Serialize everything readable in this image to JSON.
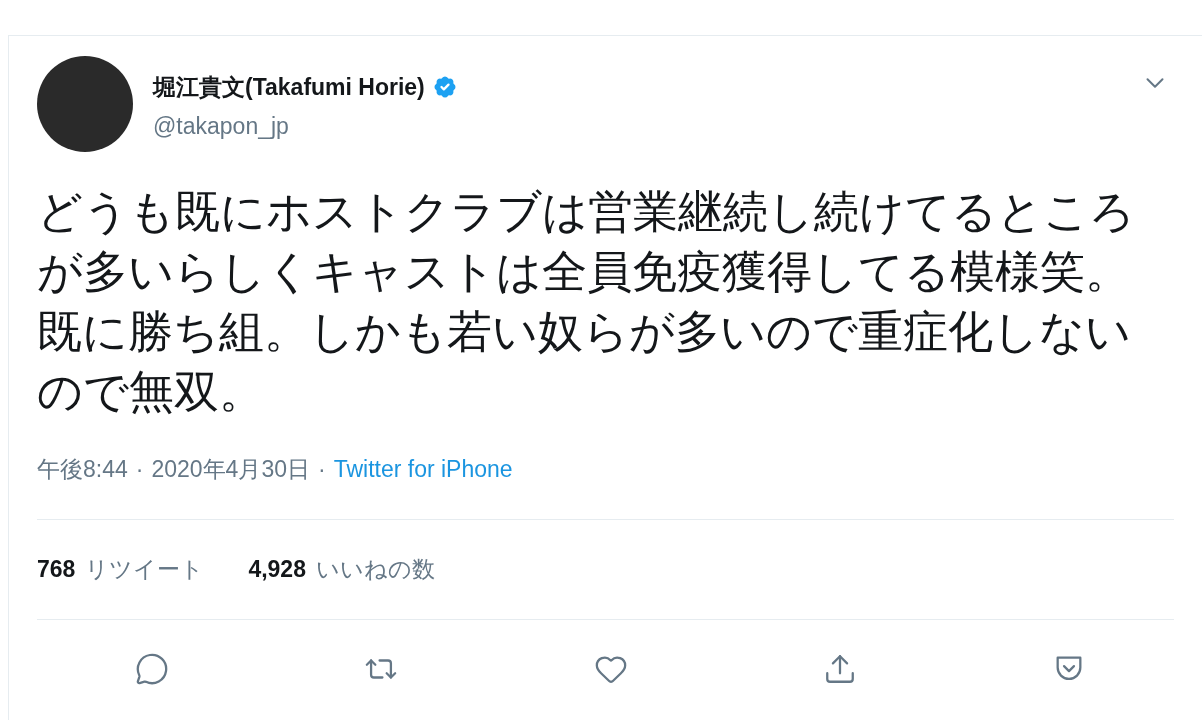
{
  "tweet": {
    "author": {
      "name": "堀江貴文(Takafumi Horie)",
      "verified": true,
      "handle": "@takapon_jp"
    },
    "text": "どうも既にホストクラブは営業継続し続けてるところが多いらしくキャストは全員免疫獲得してる模様笑。既に勝ち組。しかも若い奴らが多いので重症化しないので無双。",
    "time": "午後8:44",
    "separator_1": "·",
    "date": "2020年4月30日",
    "separator_2": "·",
    "source": "Twitter for iPhone",
    "stats": [
      {
        "count": "768",
        "label": "リツイート"
      },
      {
        "count": "4,928",
        "label": "いいねの数"
      }
    ],
    "actions": [
      {
        "kind": "reply"
      },
      {
        "kind": "retweet"
      },
      {
        "kind": "like"
      },
      {
        "kind": "share"
      },
      {
        "kind": "save"
      }
    ]
  }
}
